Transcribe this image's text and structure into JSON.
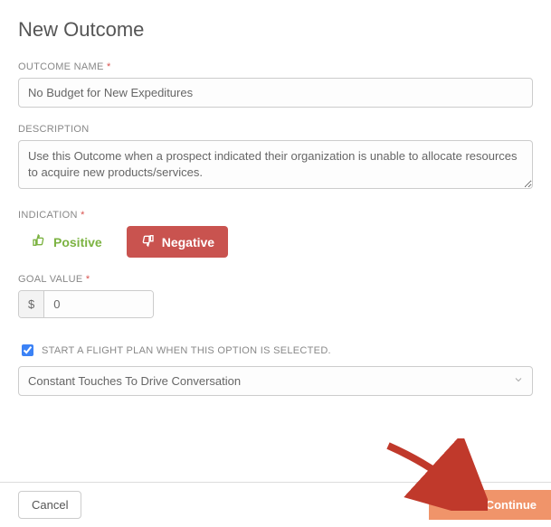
{
  "title": "New Outcome",
  "fields": {
    "outcome_name": {
      "label": "OUTCOME NAME",
      "required": "*",
      "value": "No Budget for New Expeditures"
    },
    "description": {
      "label": "DESCRIPTION",
      "value": "Use this Outcome when a prospect indicated their organization is unable to allocate resources to acquire new products/services."
    },
    "indication": {
      "label": "INDICATION",
      "required": "*",
      "positive_label": "Positive",
      "negative_label": "Negative"
    },
    "goal_value": {
      "label": "GOAL VALUE",
      "required": "*",
      "currency": "$",
      "value": "0"
    },
    "flight_plan": {
      "checkbox_label": "START A FLIGHT PLAN WHEN THIS OPTION IS SELECTED.",
      "checked": true,
      "selected": "Constant Touches To Drive Conversation"
    }
  },
  "footer": {
    "cancel": "Cancel",
    "save": "Save & Continue"
  }
}
